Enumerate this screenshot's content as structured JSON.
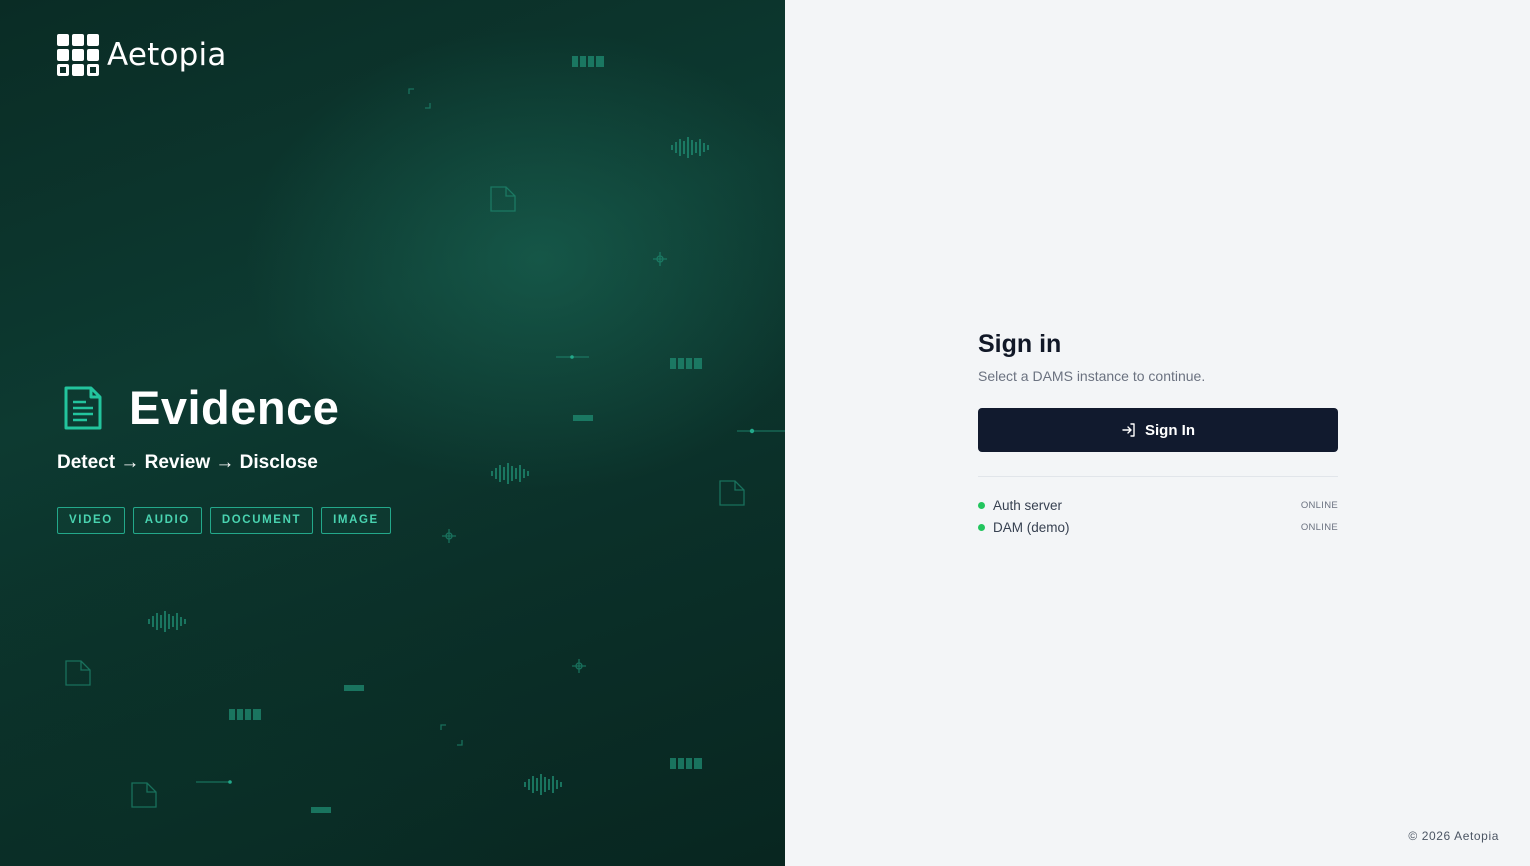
{
  "brand": {
    "name": "Aetopia"
  },
  "hero": {
    "product_title": "Evidence",
    "tagline": "Detect → Review → Disclose",
    "chips": [
      "VIDEO",
      "AUDIO",
      "DOCUMENT",
      "IMAGE"
    ]
  },
  "signin": {
    "title": "Sign in",
    "subtitle": "Select a DAMS instance to continue.",
    "button_label": "Sign In"
  },
  "services": [
    {
      "name": "Auth server",
      "state": "ONLINE"
    },
    {
      "name": "DAM (demo)",
      "state": "ONLINE"
    }
  ],
  "footer": {
    "copyright": "© 2026 Aetopia"
  },
  "colors": {
    "hero_bg": "#0b3029",
    "accent": "#23a88a",
    "button_bg": "#111a2e",
    "status_online": "#22c55e",
    "panel_bg": "#f3f5f7"
  }
}
